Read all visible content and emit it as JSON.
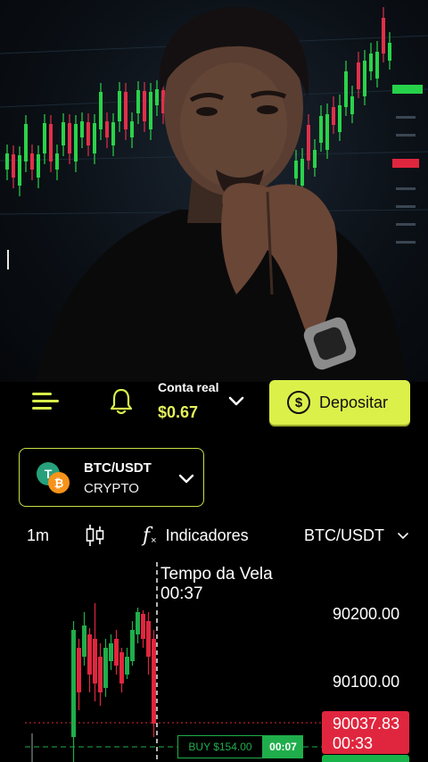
{
  "header": {
    "account_label": "Conta real",
    "account_balance": "$0.67",
    "deposit_label": "Depositar",
    "deposit_icon": "dollar-circle-icon"
  },
  "colors": {
    "accent": "#dcf04a",
    "up": "#1fae4b",
    "down": "#e0263e",
    "background": "#000000"
  },
  "asset": {
    "name": "BTC/USDT",
    "type": "CRYPTO"
  },
  "toolbar": {
    "timeframe": "1m",
    "indicators_label": "Indicadores",
    "pair_label": "BTC/USDT"
  },
  "chart": {
    "timer_label": "Tempo da Vela",
    "timer_value": "00:37",
    "price_ticks": [
      "90200.00",
      "90100.00"
    ],
    "current_price": "90037.83",
    "current_countdown": "00:33",
    "trade_label": "BUY $154.00",
    "trade_time": "00:07"
  }
}
